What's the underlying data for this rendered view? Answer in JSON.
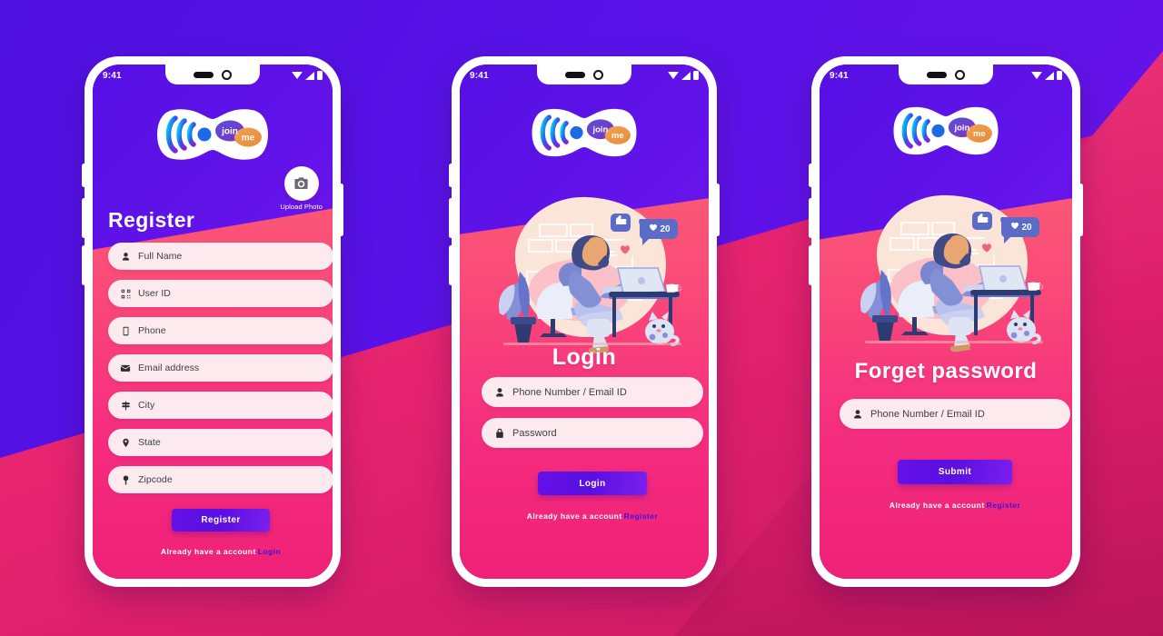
{
  "background": {
    "purple": "#5a12e8",
    "pink": "#ef2177",
    "accent_violet": "#3a14e0"
  },
  "brand": {
    "logo_name": "join-me-logo",
    "bubble_join": "join",
    "bubble_me": "me"
  },
  "status_bar": {
    "time": "9:41",
    "icons": [
      "wifi-icon",
      "signal-icon",
      "battery-icon"
    ]
  },
  "screens": [
    {
      "id": "register",
      "title": "Register",
      "upload": {
        "icon": "camera-icon",
        "label": "Upload Photo"
      },
      "fields": [
        {
          "label": "Full Name",
          "icon": "person-icon"
        },
        {
          "label": "User ID",
          "icon": "qr-code-icon"
        },
        {
          "label": "Phone",
          "icon": "mobile-icon"
        },
        {
          "label": "Email address",
          "icon": "envelope-icon"
        },
        {
          "label": "City",
          "icon": "signpost-icon"
        },
        {
          "label": "State",
          "icon": "map-pin-icon"
        },
        {
          "label": "Zipcode",
          "icon": "location-pin-icon"
        }
      ],
      "submit_label": "Register",
      "footer_text": "Already have a account",
      "footer_link": "Login"
    },
    {
      "id": "login",
      "title": "Login",
      "illustration": "person-working-on-laptop-illustration",
      "illustration_badges": [
        {
          "name": "thumbs-up-badge",
          "value": ""
        },
        {
          "name": "heart-count-badge",
          "value": "20"
        },
        {
          "name": "heart-badge",
          "value": ""
        }
      ],
      "fields": [
        {
          "label": "Phone Number / Email ID",
          "icon": "person-icon"
        },
        {
          "label": "Password",
          "icon": "lock-icon"
        }
      ],
      "submit_label": "Login",
      "footer_text": "Already have a account",
      "footer_link": "Register"
    },
    {
      "id": "forget-password",
      "title": "Forget password",
      "illustration": "person-working-on-laptop-illustration",
      "illustration_badges": [
        {
          "name": "thumbs-up-badge",
          "value": ""
        },
        {
          "name": "heart-count-badge",
          "value": "20"
        },
        {
          "name": "heart-badge",
          "value": ""
        }
      ],
      "fields": [
        {
          "label": "Phone Number / Email ID",
          "icon": "person-icon"
        }
      ],
      "submit_label": "Submit",
      "footer_text": "Already have a account",
      "footer_link": "Register"
    }
  ]
}
